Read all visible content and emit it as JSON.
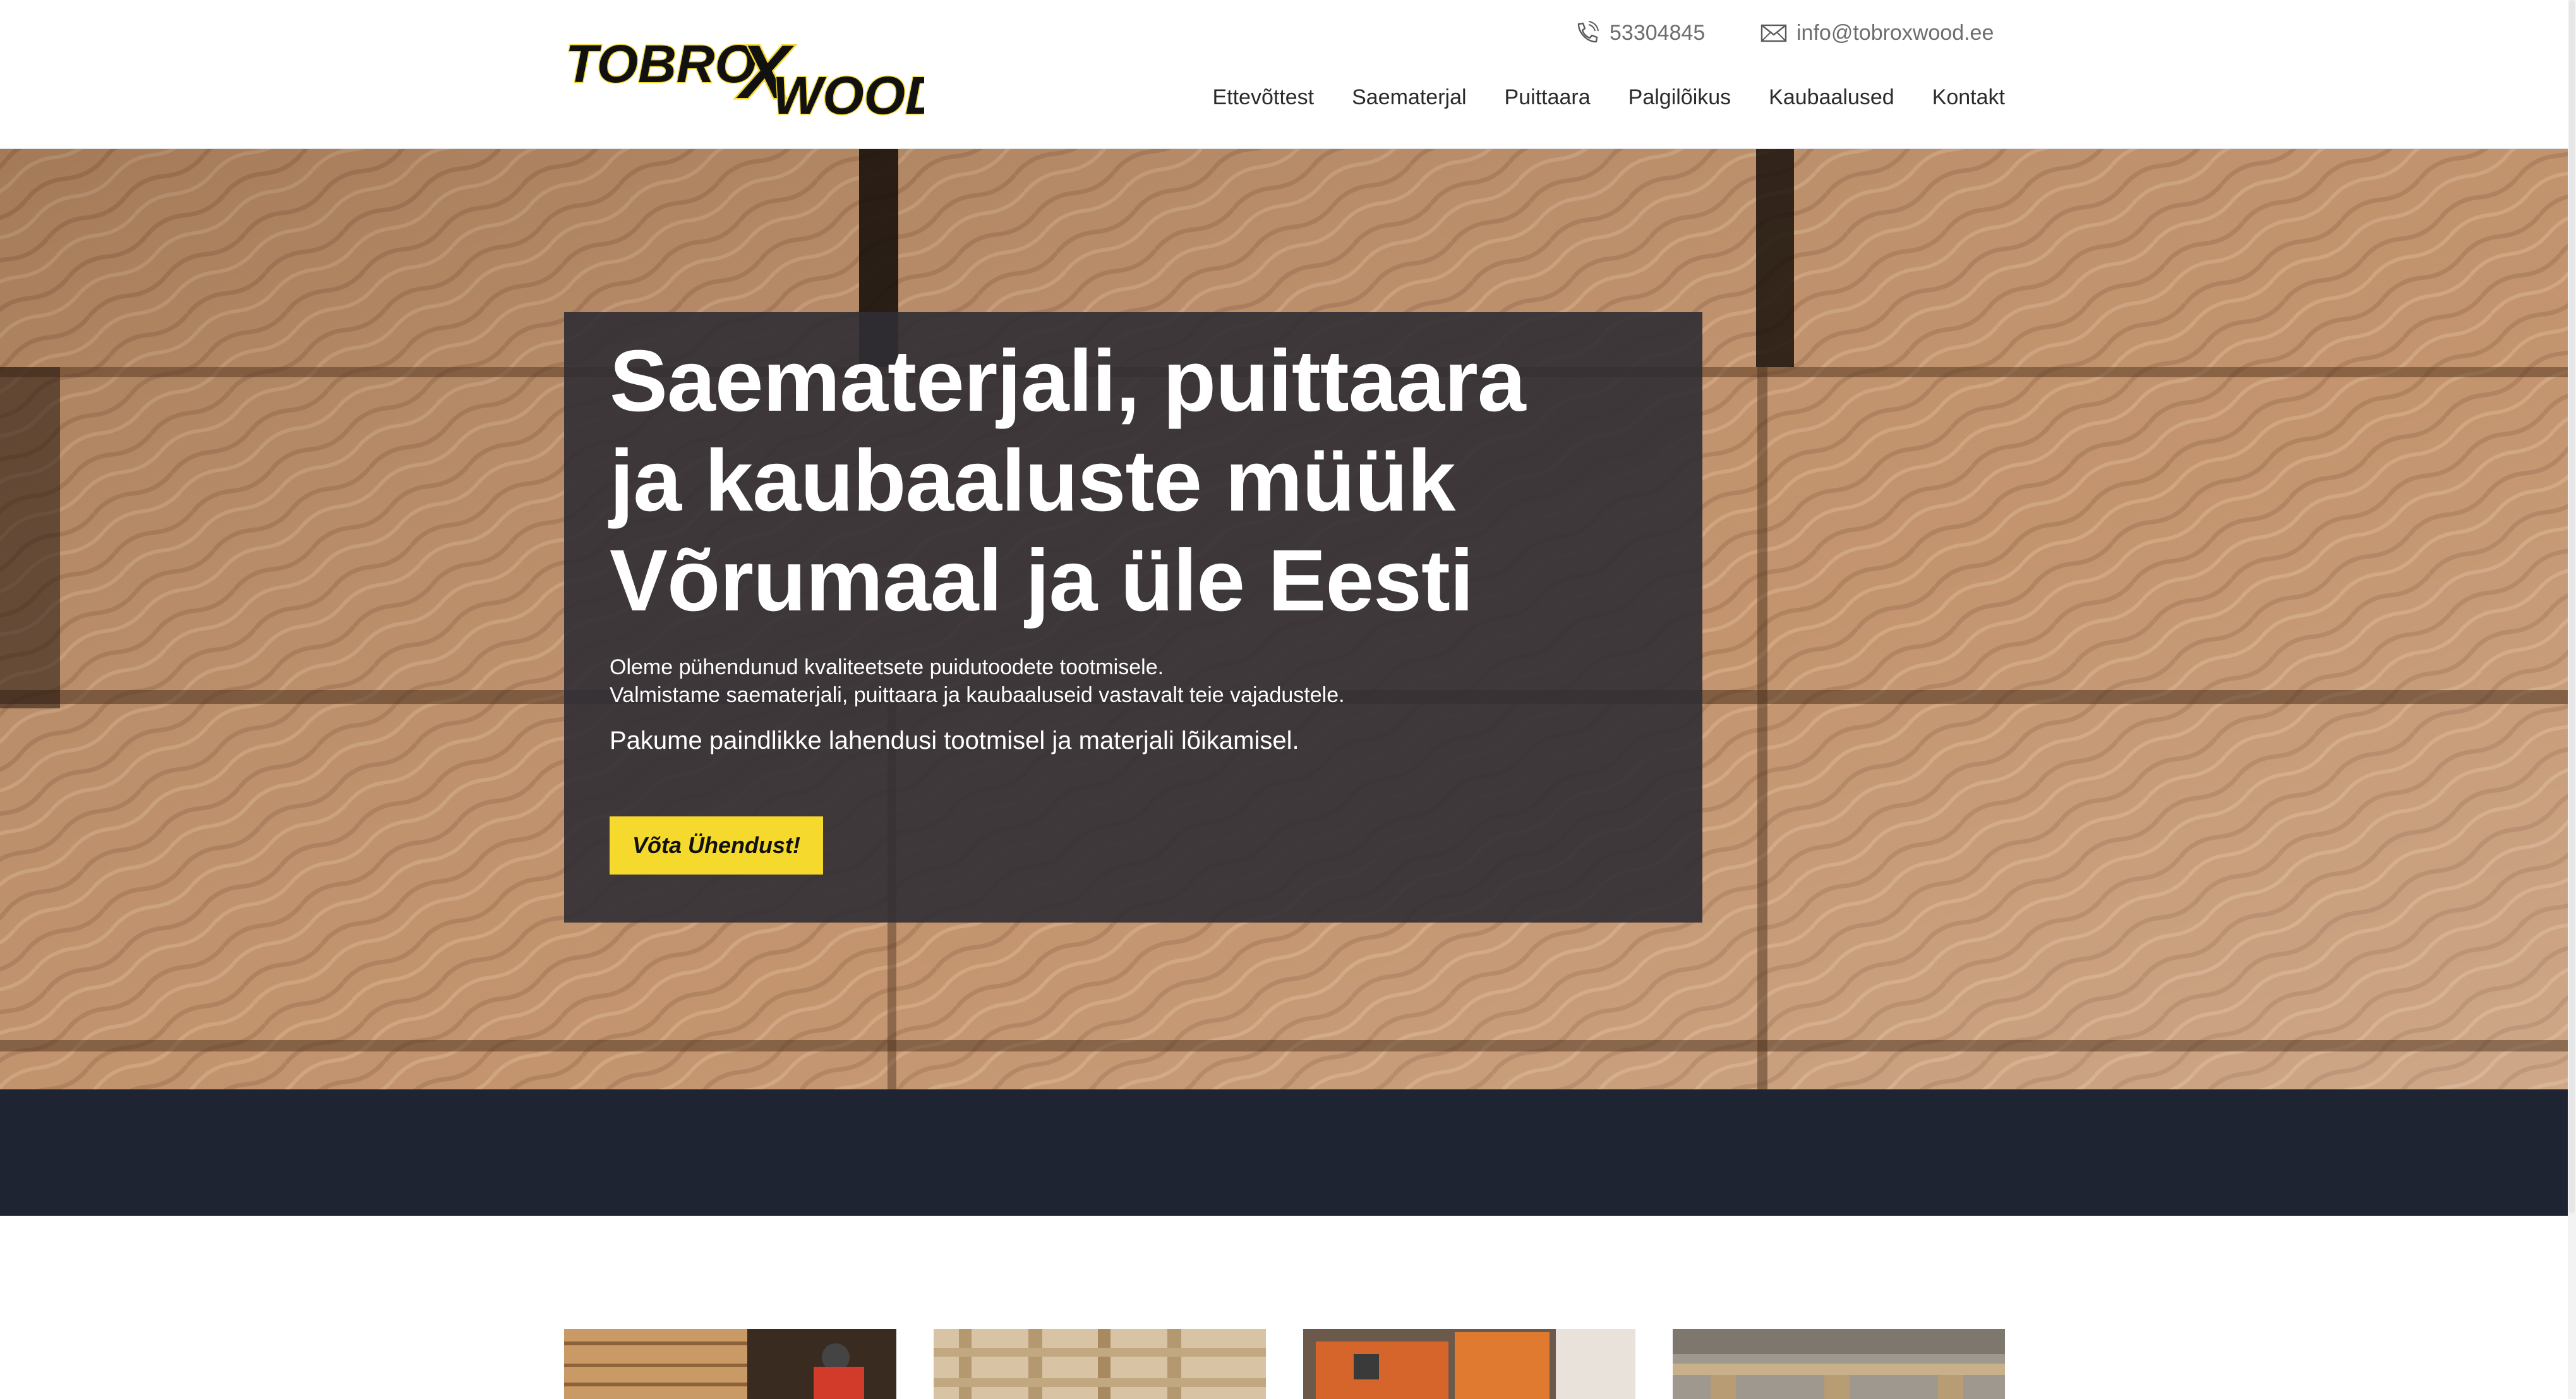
{
  "brand": {
    "logo_text_1": "TOBRO",
    "logo_text_x": "X",
    "logo_text_2": "WOOD",
    "accent": "#f5d92d",
    "dark": "#1f2433"
  },
  "contact": {
    "phone": "53304845",
    "email": "info@tobroxwood.ee",
    "phone_icon": "phone-icon",
    "email_icon": "envelope-icon"
  },
  "nav": {
    "items": [
      {
        "label": "Ettevõttest"
      },
      {
        "label": "Saematerjal"
      },
      {
        "label": "Puittaara"
      },
      {
        "label": "Palgilõikus"
      },
      {
        "label": "Kaubaalused"
      },
      {
        "label": "Kontakt"
      }
    ]
  },
  "hero": {
    "title_line_1": "Saematerjali, puittaara",
    "title_line_2": "ja kaubaaluste müük",
    "title_line_3": "Võrumaal ja üle Eesti",
    "text_1": "Oleme pühendunud kvaliteetsete puidutoodete tootmisele.",
    "text_2": "Valmistame saematerjali, puittaara ja kaubaaluseid vastavalt teie vajadustele.",
    "text_3": "Pakume paindlikke lahendusi tootmisel ja materjali lõikamisel.",
    "cta_label": "Võta Ühendust!"
  }
}
